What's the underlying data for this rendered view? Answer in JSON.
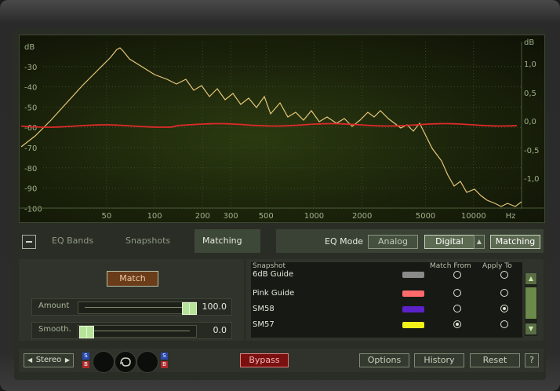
{
  "graph": {
    "db_labels": [
      "dB",
      "-30",
      "-40",
      "-50",
      "-60",
      "-70",
      "-80",
      "-90",
      "-100"
    ],
    "right_labels": [
      "dB",
      "1,0",
      "0,5",
      "0,0",
      "-0,5",
      "-1,0"
    ],
    "freq_labels": [
      "50",
      "100",
      "200",
      "300",
      "500",
      "1000",
      "2000",
      "5000",
      "10000",
      "Hz"
    ],
    "colors": {
      "spectrum": "#e7c778",
      "eq_curve": "#e02a2a",
      "grid": "#3d4a2e"
    }
  },
  "tabs": {
    "collapse_icon": "minus-icon",
    "items": [
      {
        "label": "EQ Bands",
        "active": false
      },
      {
        "label": "Snapshots",
        "active": false
      },
      {
        "label": "Matching",
        "active": true
      }
    ]
  },
  "eq_mode": {
    "label": "EQ Mode",
    "options": [
      "Analog",
      "Digital"
    ],
    "selected": "Digital",
    "matching_label": "Matching"
  },
  "matching_panel": {
    "match_label": "Match",
    "amount": {
      "label": "Amount",
      "value": "100.0",
      "fraction": 1.0
    },
    "smooth": {
      "label": "Smooth.",
      "value": "0.0",
      "fraction": 0.0
    }
  },
  "snapshot_list": {
    "headers": {
      "snapshot": "Snapshot",
      "match_from": "Match From",
      "apply_to": "Apply To"
    },
    "rows": [
      {
        "name": "6dB Guide",
        "color": "#8a8a8a",
        "match_from": false,
        "apply_to": false
      },
      {
        "name": "Pink Guide",
        "color": "#ff6a6a",
        "match_from": false,
        "apply_to": false
      },
      {
        "name": "SM58",
        "color": "#5a22c8",
        "match_from": false,
        "apply_to": true
      },
      {
        "name": "SM57",
        "color": "#f2f21a",
        "match_from": true,
        "apply_to": false
      }
    ]
  },
  "bottom": {
    "stereo_label": "Stereo",
    "s_label": "S",
    "b_label": "B",
    "bypass_label": "Bypass",
    "options_label": "Options",
    "history_label": "History",
    "reset_label": "Reset",
    "help_label": "?"
  }
}
